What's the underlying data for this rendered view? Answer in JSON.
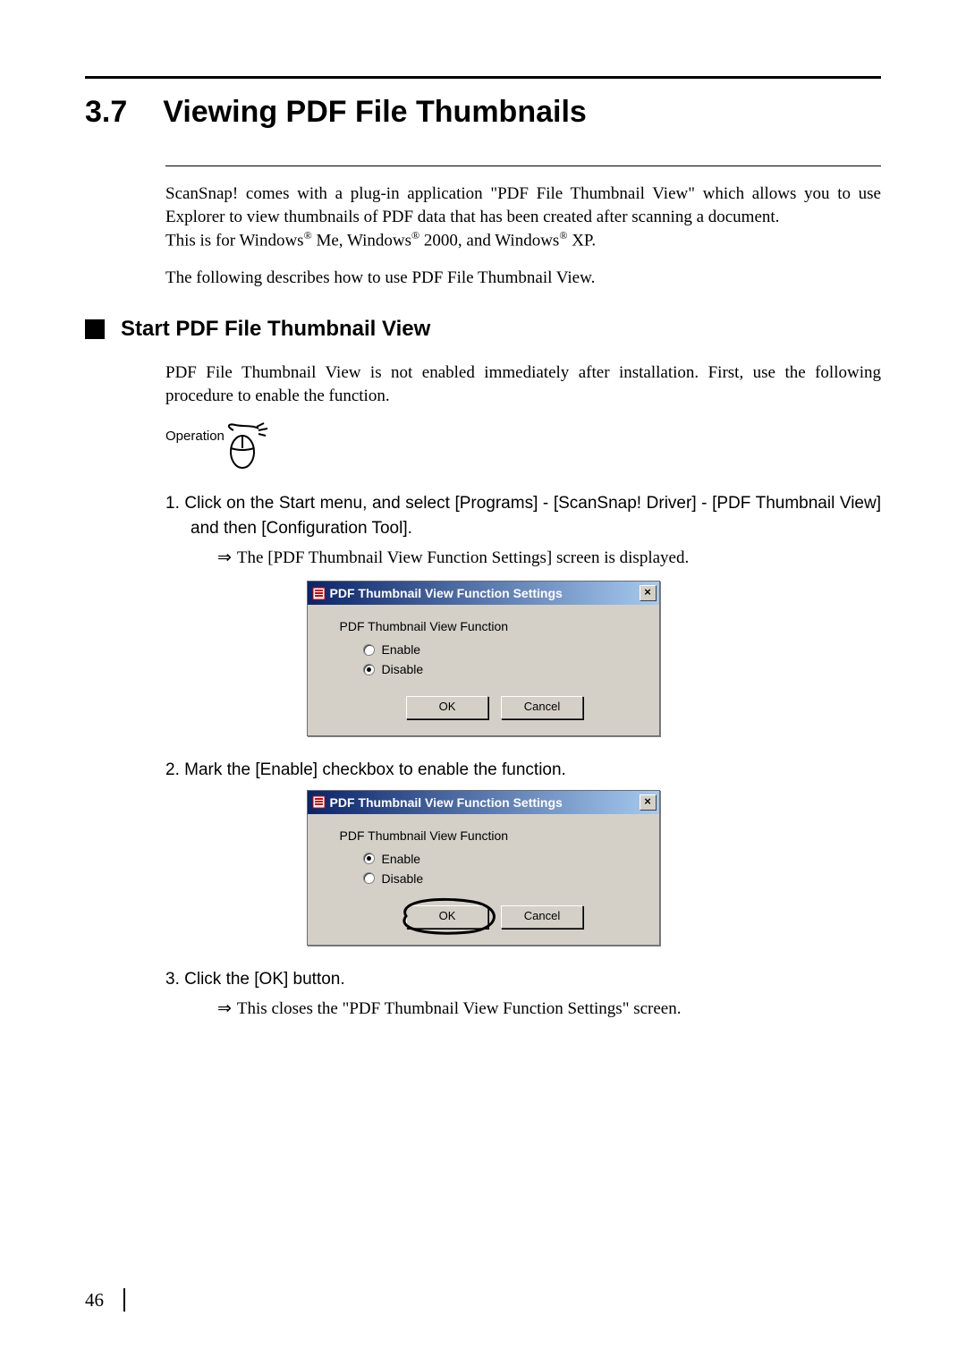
{
  "section": {
    "number": "3.7",
    "title": "Viewing PDF File Thumbnails"
  },
  "intro": {
    "p1a": "ScanSnap! comes with a plug-in application \"PDF File Thumbnail View\" which allows you to use Explorer to view thumbnails of PDF data that has been created after scanning a document.",
    "p1b_prefix": "This is for Windows",
    "p1b_me": " Me, Windows",
    "p1b_2000": " 2000, and Windows",
    "p1b_xp": " XP.",
    "reg": "®",
    "p2": "The following describes how to use PDF File Thumbnail View."
  },
  "sub": {
    "title": "Start PDF File Thumbnail View",
    "para": "PDF File Thumbnail View is not enabled immediately after installation. First, use the following procedure to enable the function."
  },
  "operation_label": "Operation",
  "steps": {
    "s1": "1.  Click on the Start menu, and select [Programs] - [ScanSnap! Driver] - [PDF Thumbnail View] and then [Configuration Tool].",
    "s1_result": "The [PDF Thumbnail View Function Settings] screen is displayed.",
    "s2": "2.  Mark the [Enable] checkbox to enable the function.",
    "s3": "3.  Click the [OK] button.",
    "s3_result": "This closes the \"PDF Thumbnail View Function Settings\" screen."
  },
  "arrow": "⇒",
  "dialog": {
    "title": "PDF Thumbnail View Function Settings",
    "close": "×",
    "group": "PDF Thumbnail View Function",
    "enable": "Enable",
    "disable": "Disable",
    "ok": "OK",
    "cancel": "Cancel"
  },
  "page_number": "46"
}
